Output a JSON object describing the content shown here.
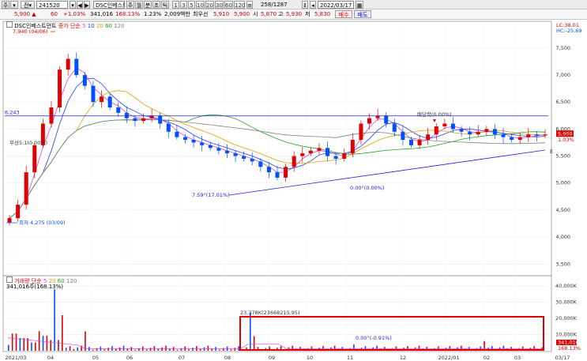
{
  "toolbar": {
    "code": "241520",
    "name": "DSC인베스트",
    "modes": [
      "주",
      "월",
      "분",
      "초",
      "틱"
    ],
    "periods": [
      "1",
      "3",
      "5",
      "10",
      "20",
      "30",
      "60",
      "120"
    ],
    "count": "258",
    "total": "1287",
    "date": "2022/03/17"
  },
  "quote": {
    "price": "5,900",
    "change": "60",
    "change_pct": "+1.03%",
    "volume": "341,016",
    "volume_pct": "168.13%",
    "turnover": "1.23%",
    "value": "2,009백만",
    "value_label": "최우선",
    "best": "5,910",
    "best2": "5,900",
    "open_label": "시",
    "open": "5,870",
    "high_label": "고",
    "high": "5,930",
    "low_label": "저",
    "low": "5,830",
    "buy_label": "매수",
    "sell_label": "매도"
  },
  "price_legend": {
    "name": "DSC인베스트먼트",
    "series": "종가 단순",
    "mas": [
      "5",
      "10",
      "20",
      "60",
      "120"
    ]
  },
  "volume_legend": {
    "name": "거래량",
    "series": "단순",
    "mas": [
      "5",
      "20",
      "60",
      "120"
    ],
    "value": "341,016주(168.13%)"
  },
  "colors": {
    "up": "#e00000",
    "down": "#0050ff",
    "ma5": "#e040e0",
    "ma10": "#2040ff",
    "ma20": "#e0a000",
    "ma60": "#20a020",
    "ma120": "#808080",
    "trend": "#2020e0",
    "highlight": "#e00000"
  },
  "chart_data": {
    "type": "candlestick",
    "price_axis": {
      "min": 3500,
      "max": 7500,
      "ticks": [
        "7,500",
        "7,000",
        "6,500",
        "6,000",
        "5,500",
        "5,000",
        "4,500",
        "4,000",
        "3,500"
      ]
    },
    "volume_axis": {
      "ticks": [
        "40,000K",
        "30,000K",
        "20,000K",
        "10,000K"
      ]
    },
    "x_labels": [
      "2021/03",
      "04",
      "05",
      "06",
      "07",
      "08",
      "09",
      "10",
      "11",
      "12",
      "2022/01",
      "02",
      "03",
      "03/17"
    ],
    "annotations": {
      "high": "7,940 (04/06)",
      "low": "최저 4,275 (03/09)",
      "left_mark": "무상5:1(0.00%)",
      "dividend": "배당락(0.00%)",
      "trend_low": "7.59°(17.01%)",
      "trend_mid": "0.00°(0.00%)",
      "hline_value": "6,243",
      "vol_peak": "23,378K(23668215.95)",
      "vol_note": "0.00°(-0.91%)",
      "top_right_1": "LC:38.01",
      "top_right_2": "HC:-25.69",
      "tag_price": "5,900",
      "tag_pct": "1.03%",
      "tag_vol": "341,016",
      "tag_vol_pct": "168.13%",
      "edge_mark": "E"
    },
    "close": [
      4350,
      4600,
      5200,
      5700,
      6100,
      6400,
      7100,
      7300,
      7000,
      6800,
      6500,
      6600,
      6400,
      6300,
      6200,
      6150,
      6200,
      6250,
      6100,
      5950,
      5850,
      5800,
      5750,
      5700,
      5650,
      5600,
      5550,
      5500,
      5450,
      5400,
      5300,
      5200,
      5100,
      5300,
      5500,
      5550,
      5600,
      5650,
      5500,
      5450,
      5550,
      5800,
      6100,
      6200,
      6250,
      6100,
      5950,
      5800,
      5700,
      5800,
      5900,
      6050,
      6100,
      6000,
      5950,
      5900,
      5950,
      6000,
      5900,
      5850,
      5800,
      5850,
      5900,
      5880,
      5900
    ],
    "volume_spikes": [
      {
        "label": "2021/03",
        "v": 8
      },
      {
        "label": "04",
        "v": 38
      },
      {
        "label": "04b",
        "v": 22
      },
      {
        "label": "08",
        "v": 23.4
      },
      {
        "label": "11",
        "v": 4
      },
      {
        "label": "12",
        "v": 3
      },
      {
        "label": "02",
        "v": 6
      }
    ]
  }
}
